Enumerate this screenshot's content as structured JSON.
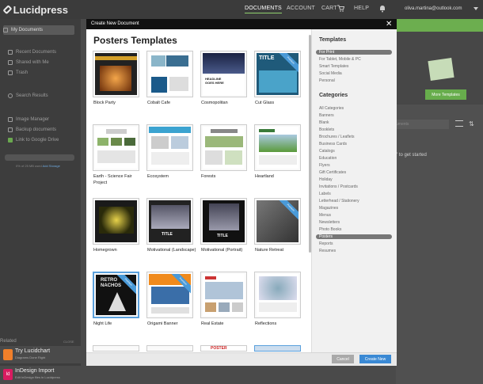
{
  "app": {
    "logo_text": "Lucidpress"
  },
  "topnav": {
    "items": [
      {
        "label": "DOCUMENTS",
        "active": true
      },
      {
        "label": "ACCOUNT",
        "active": false
      },
      {
        "label": "CART",
        "active": false
      },
      {
        "label": "HELP",
        "active": false
      }
    ],
    "cart_icon": "cart-icon",
    "bell_icon": "bell-icon",
    "user_email": "oliva.martina@outlook.com"
  },
  "sidebar": {
    "my_documents": "My Documents",
    "items": [
      {
        "label": "Recent Documents",
        "icon": "clock-icon"
      },
      {
        "label": "Shared with Me",
        "icon": "people-icon"
      },
      {
        "label": "Trash",
        "icon": "trash-icon"
      },
      {
        "label": "Search Results",
        "icon": "search-icon"
      },
      {
        "label": "Image Manager",
        "icon": "image-icon"
      },
      {
        "label": "Backup documents",
        "icon": "backup-icon"
      },
      {
        "label": "Link to Google Drive",
        "icon": "drive-icon"
      }
    ],
    "storage_text": "0% of 25 MB used",
    "storage_link": "Add Storage",
    "related": "Related",
    "close_related": "CLOSE",
    "promos": [
      {
        "title": "Try Lucidchart",
        "subtitle": "Diagrams Done Right",
        "color": "#f07f2a"
      },
      {
        "title": "InDesign Import",
        "subtitle": "Edit InDesign files in Lucidpress",
        "color": "#d81b60"
      }
    ]
  },
  "background": {
    "more_templates": "More Templates",
    "search_placeholder": "uments",
    "get_started": "\" to get started"
  },
  "modal": {
    "header": "Create New Document",
    "title": "Posters Templates",
    "close_icon": "close-icon",
    "cancel": "Cancel",
    "create": "Create New"
  },
  "templates": [
    {
      "name": "Block Party",
      "premium": false
    },
    {
      "name": "Cobalt Cafe",
      "premium": false
    },
    {
      "name": "Cosmopolitan",
      "premium": false
    },
    {
      "name": "Cut Glass",
      "premium": true
    },
    {
      "name": "Earth - Science Fair Project",
      "premium": false
    },
    {
      "name": "Ecosystem",
      "premium": false
    },
    {
      "name": "Forests",
      "premium": false
    },
    {
      "name": "Heartland",
      "premium": false
    },
    {
      "name": "Homegrown",
      "premium": false
    },
    {
      "name": "Motivational (Landscape)",
      "premium": false
    },
    {
      "name": "Motivational (Portrait)",
      "premium": false
    },
    {
      "name": "Nature Retreat",
      "premium": true
    },
    {
      "name": "Night Life",
      "premium": true
    },
    {
      "name": "Origami Banner",
      "premium": true
    },
    {
      "name": "Real Estate",
      "premium": false
    },
    {
      "name": "Reflections",
      "premium": false
    }
  ],
  "thumb_text": {
    "poster3_line1": "HEADLINE",
    "poster3_line2": "GOES HERE",
    "poster4_title": "TITLE",
    "poster10_title": "TITLE",
    "poster11_title": "TITLE",
    "poster13_line1": "RETRO",
    "poster13_line2": "NACHOS",
    "poster19_title": "POSTER"
  },
  "ribbon_text": "Premium",
  "right_panel": {
    "templates_heading": "Templates",
    "template_types": [
      {
        "label": "For Print",
        "selected": true
      },
      {
        "label": "For Tablet, Mobile & PC",
        "selected": false
      },
      {
        "label": "Smart Templates",
        "selected": false
      },
      {
        "label": "Social Media",
        "selected": false
      },
      {
        "label": "Personal",
        "selected": false
      }
    ],
    "categories_heading": "Categories",
    "categories": [
      {
        "label": "All Categories",
        "selected": false
      },
      {
        "label": "Banners",
        "selected": false
      },
      {
        "label": "Blank",
        "selected": false
      },
      {
        "label": "Booklets",
        "selected": false
      },
      {
        "label": "Brochures / Leaflets",
        "selected": false
      },
      {
        "label": "Business Cards",
        "selected": false
      },
      {
        "label": "Catalogs",
        "selected": false
      },
      {
        "label": "Education",
        "selected": false
      },
      {
        "label": "Flyers",
        "selected": false
      },
      {
        "label": "Gift Certificates",
        "selected": false
      },
      {
        "label": "Holiday",
        "selected": false
      },
      {
        "label": "Invitations / Postcards",
        "selected": false
      },
      {
        "label": "Labels",
        "selected": false
      },
      {
        "label": "Letterhead / Stationery",
        "selected": false
      },
      {
        "label": "Magazines",
        "selected": false
      },
      {
        "label": "Menus",
        "selected": false
      },
      {
        "label": "Newsletters",
        "selected": false
      },
      {
        "label": "Photo Books",
        "selected": false
      },
      {
        "label": "Posters",
        "selected": true
      },
      {
        "label": "Reports",
        "selected": false
      },
      {
        "label": "Resumes",
        "selected": false
      }
    ]
  }
}
